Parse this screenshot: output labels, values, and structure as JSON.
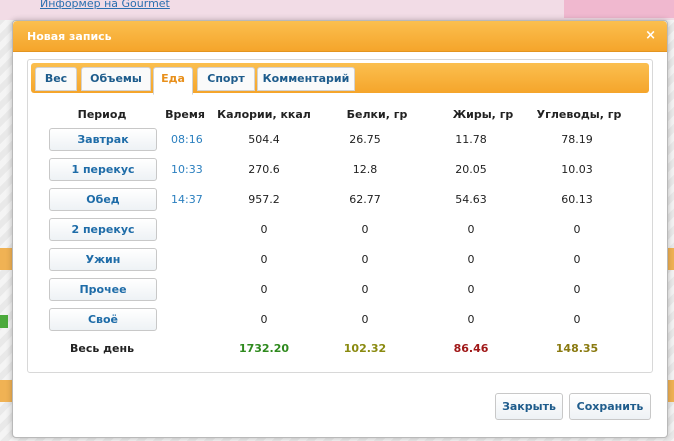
{
  "background": {
    "top_link": "Информер на Gourmet"
  },
  "dialog": {
    "title": "Новая запись"
  },
  "tabs": [
    {
      "label": "Вес"
    },
    {
      "label": "Объемы"
    },
    {
      "label": "Еда"
    },
    {
      "label": "Спорт"
    },
    {
      "label": "Комментарий"
    }
  ],
  "table": {
    "headers": [
      "Период",
      "Время",
      "Калории, ккал",
      "Белки, гр",
      "Жиры, гр",
      "Углеводы, гр"
    ],
    "rows": [
      {
        "period": "Завтрак",
        "time": "08:16",
        "kcal": "504.4",
        "protein": "26.75",
        "fat": "11.78",
        "carbs": "78.19"
      },
      {
        "period": "1 перекус",
        "time": "10:33",
        "kcal": "270.6",
        "protein": "12.8",
        "fat": "20.05",
        "carbs": "10.03"
      },
      {
        "period": "Обед",
        "time": "14:37",
        "kcal": "957.2",
        "protein": "62.77",
        "fat": "54.63",
        "carbs": "60.13"
      },
      {
        "period": "2 перекус",
        "time": "",
        "kcal": "0",
        "protein": "0",
        "fat": "0",
        "carbs": "0"
      },
      {
        "period": "Ужин",
        "time": "",
        "kcal": "0",
        "protein": "0",
        "fat": "0",
        "carbs": "0"
      },
      {
        "period": "Прочее",
        "time": "",
        "kcal": "0",
        "protein": "0",
        "fat": "0",
        "carbs": "0"
      },
      {
        "period": "Своё",
        "time": "",
        "kcal": "0",
        "protein": "0",
        "fat": "0",
        "carbs": "0"
      }
    ],
    "totals": {
      "label": "Весь день",
      "kcal": "1732.20",
      "protein": "102.32",
      "fat": "86.46",
      "carbs": "148.35"
    }
  },
  "colors": {
    "accent": "#f5a52b",
    "total_kcal": "#2f8a1e",
    "total_protein": "#8a8a10",
    "total_fat": "#a01818",
    "total_carbs": "#8a7a10"
  },
  "buttons": {
    "close_label": "Закрыть",
    "save_label": "Сохранить",
    "close_icon": "×"
  }
}
